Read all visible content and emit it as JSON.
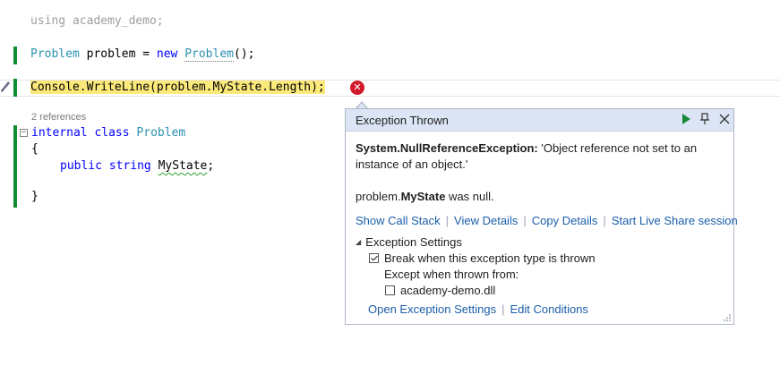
{
  "code": {
    "using_kw": "using",
    "using_ns": "academy_demo;",
    "l2_type": "Problem",
    "l2_var": " problem = ",
    "l2_new": "new",
    "l2_ctor": "Problem",
    "l2_end": "();",
    "l3_text": "Console.WriteLine(problem.MyState.Length);",
    "codelens": "2 references",
    "class_mod": "internal",
    "class_kw": "class",
    "class_name": "Problem",
    "open_brace": "{",
    "field_mod": "public",
    "field_type": "string",
    "field_name": "MyState",
    "field_end": ";",
    "close_brace": "}"
  },
  "popup": {
    "title": "Exception Thrown",
    "exception_type": "System.NullReferenceException:",
    "exception_msg": " 'Object reference not set to an instance of an object.'",
    "null_prefix": "problem.",
    "null_member": "MyState",
    "null_suffix": " was null.",
    "links": [
      "Show Call Stack",
      "View Details",
      "Copy Details",
      "Start Live Share session"
    ],
    "settings_label": "Exception Settings",
    "break_label": "Break when this exception type is thrown",
    "break_checked": true,
    "except_label": "Except when thrown from:",
    "module_label": "academy-demo.dll",
    "module_checked": false,
    "footer_links": [
      "Open Exception Settings",
      "Edit Conditions"
    ]
  },
  "colors": {
    "keyword": "#0000ff",
    "type": "#2b91af",
    "highlight": "#fbe97a",
    "error": "#d11b2b",
    "link": "#1a5ea8",
    "header_bg": "#dce5f5",
    "change_bar": "#108d33"
  },
  "icons": {
    "error": "error-circle-icon",
    "play": "continue-play-icon",
    "pin": "pin-icon",
    "close": "close-icon",
    "pen": "edit-pen-icon"
  }
}
